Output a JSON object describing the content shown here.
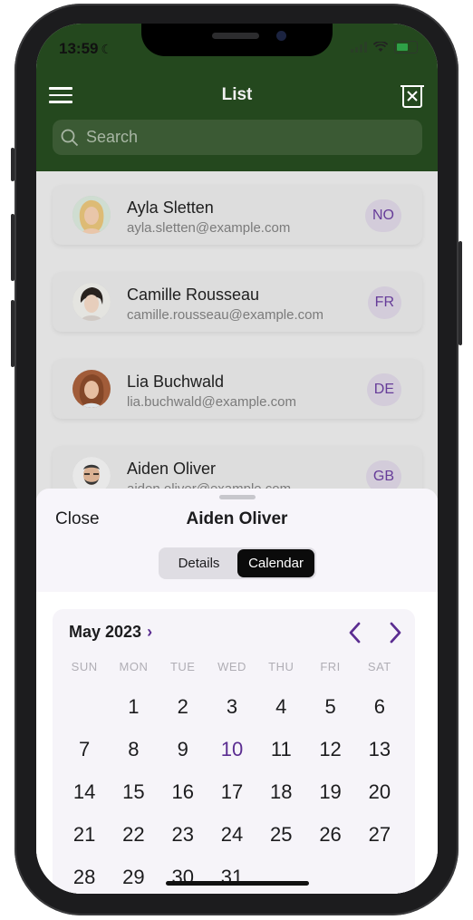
{
  "status": {
    "time": "13:59"
  },
  "header": {
    "title": "List"
  },
  "search": {
    "placeholder": "Search"
  },
  "contacts": [
    {
      "name": "Ayla Sletten",
      "email": "ayla.sletten@example.com",
      "country": "NO"
    },
    {
      "name": "Camille Rousseau",
      "email": "camille.rousseau@example.com",
      "country": "FR"
    },
    {
      "name": "Lia Buchwald",
      "email": "lia.buchwald@example.com",
      "country": "DE"
    },
    {
      "name": "Aiden Oliver",
      "email": "aiden.oliver@example.com",
      "country": "GB"
    }
  ],
  "sheet": {
    "close_label": "Close",
    "title": "Aiden Oliver",
    "tabs": [
      {
        "label": "Details",
        "selected": false
      },
      {
        "label": "Calendar",
        "selected": true
      }
    ]
  },
  "calendar": {
    "month_label": "May 2023",
    "weekdays": [
      "SUN",
      "MON",
      "TUE",
      "WED",
      "THU",
      "FRI",
      "SAT"
    ],
    "days": [
      "",
      "1",
      "2",
      "3",
      "4",
      "5",
      "6",
      "7",
      "8",
      "9",
      "10",
      "11",
      "12",
      "13",
      "14",
      "15",
      "16",
      "17",
      "18",
      "19",
      "20",
      "21",
      "22",
      "23",
      "24",
      "25",
      "26",
      "27",
      "28",
      "29",
      "30",
      "31"
    ],
    "highlighted_day": "10"
  },
  "colors": {
    "header": "#24481e",
    "accent": "#5b2d91",
    "badge_bg": "#dcd5e3"
  },
  "icons": {
    "menu": "hamburger-icon",
    "trash": "trash-x-icon",
    "search": "magnifier-icon",
    "prev": "chevron-left-icon",
    "next": "chevron-right-icon"
  }
}
